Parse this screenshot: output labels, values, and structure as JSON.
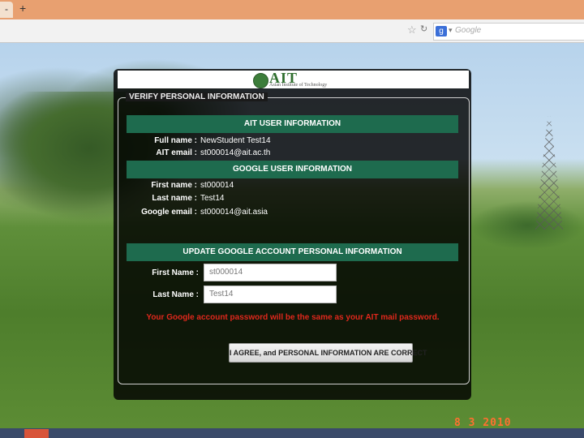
{
  "browser": {
    "tab_label": "-",
    "new_tab": "+",
    "search_placeholder": "Google",
    "search_engine_icon": "g"
  },
  "page": {
    "logo_text": "AIT",
    "logo_subtitle": "Asian Institute of Technology",
    "section_title": "VERIFY PERSONAL INFORMATION",
    "ait_section": {
      "heading": "AIT USER INFORMATION",
      "rows": [
        {
          "label": "Full name :",
          "value": "NewStudent Test14"
        },
        {
          "label": "AIT email :",
          "value": "st000014@ait.ac.th"
        }
      ]
    },
    "google_section": {
      "heading": "GOOGLE USER INFORMATION",
      "rows": [
        {
          "label": "First name :",
          "value": "st000014"
        },
        {
          "label": "Last name :",
          "value": "Test14"
        },
        {
          "label": "Google email :",
          "value": "st000014@ait.asia"
        }
      ]
    },
    "update_section": {
      "heading": "UPDATE GOOGLE ACCOUNT PERSONAL INFORMATION",
      "first_name_label": "First Name :",
      "first_name_value": "st000014",
      "last_name_label": "Last Name :",
      "last_name_value": "Test14"
    },
    "warning": "Your Google account password will be the same as your AIT mail password.",
    "agree_button": "I AGREE, and PERSONAL INFORMATION ARE CORRECT"
  },
  "photo": {
    "date_stamp": "8 3 2010"
  },
  "colors": {
    "section_header": "#1e6b4e",
    "warning": "#e0281c",
    "panel": "#111111"
  }
}
